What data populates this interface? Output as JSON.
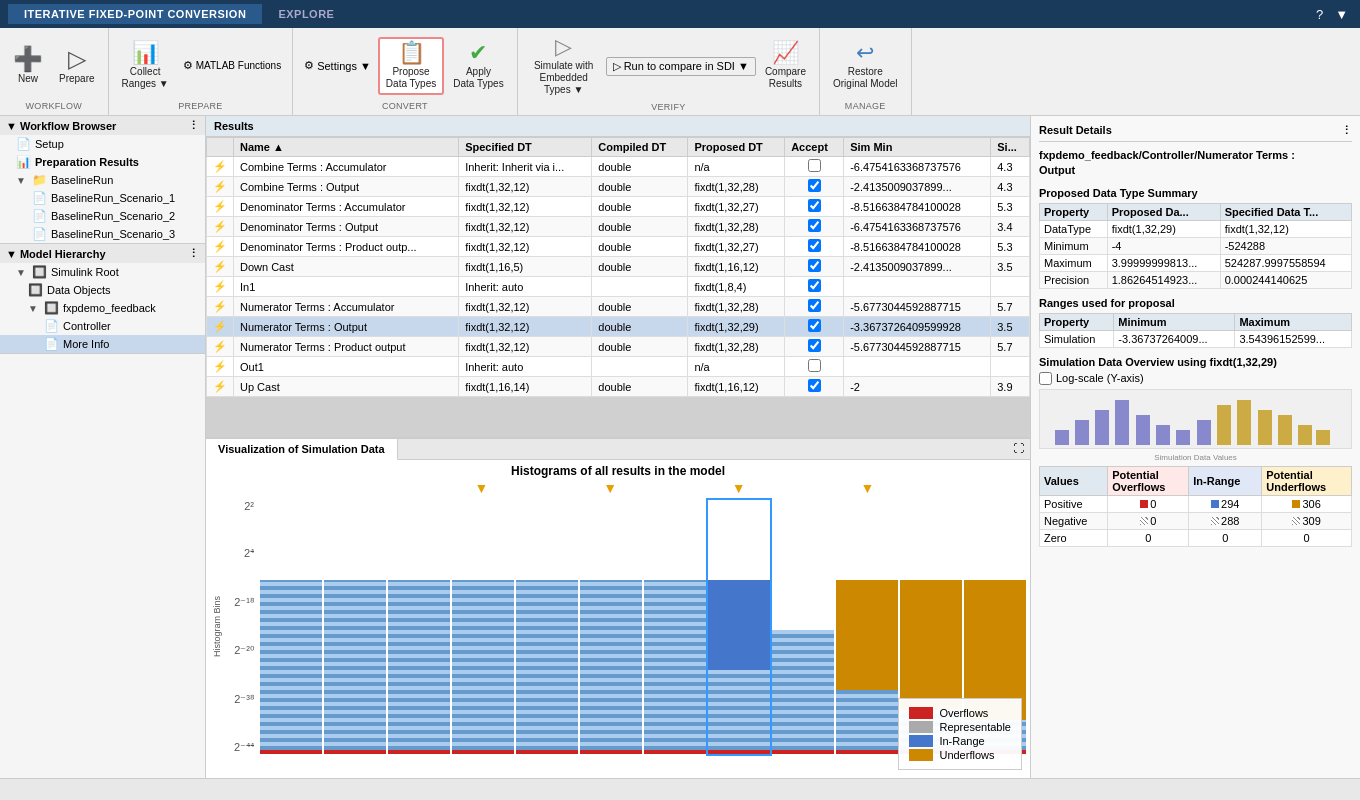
{
  "titleBar": {
    "tabs": [
      {
        "id": "iterative",
        "label": "ITERATIVE FIXED-POINT CONVERSION",
        "active": true
      },
      {
        "id": "explore",
        "label": "EXPLORE",
        "active": false
      }
    ],
    "helpBtn": "?",
    "menuBtn": "▼"
  },
  "ribbon": {
    "groups": [
      {
        "id": "workflow",
        "label": "WORKFLOW",
        "items": [
          {
            "id": "new",
            "icon": "➕",
            "label": "New",
            "type": "btn"
          },
          {
            "id": "prepare",
            "icon": "▶",
            "label": "Prepare",
            "type": "btn"
          }
        ]
      },
      {
        "id": "prepare",
        "label": "PREPARE",
        "items": [
          {
            "id": "collect-ranges",
            "icon": "📊",
            "label": "Collect\nRanges",
            "type": "split"
          },
          {
            "id": "matlab-functions",
            "icon": "⚙",
            "label": "MATLAB Functions",
            "type": "small"
          }
        ]
      },
      {
        "id": "convert",
        "label": "CONVERT",
        "items": [
          {
            "id": "settings",
            "icon": "⚙",
            "label": "Settings ▼",
            "type": "settings"
          },
          {
            "id": "propose-data-types",
            "icon": "📋",
            "label": "Propose\nData Types",
            "type": "btn",
            "active": true
          },
          {
            "id": "apply-data",
            "icon": "✅",
            "label": "Apply\nData Types",
            "type": "btn"
          }
        ]
      },
      {
        "id": "verify",
        "label": "VERIFY",
        "items": [
          {
            "id": "simulate-embedded",
            "icon": "▶",
            "label": "Simulate with\nEmbedded Types",
            "type": "split"
          },
          {
            "id": "run-to-compare",
            "icon": "▶",
            "label": "Run to compare in SDI",
            "type": "run"
          },
          {
            "id": "compare-results",
            "icon": "📈",
            "label": "Compare\nResults",
            "type": "btn"
          }
        ]
      },
      {
        "id": "manage",
        "label": "MANAGE",
        "items": [
          {
            "id": "restore-original",
            "icon": "↩",
            "label": "Restore\nOriginal Model",
            "type": "btn"
          }
        ]
      }
    ]
  },
  "sidebar": {
    "workflowBrowser": {
      "title": "Workflow Browser",
      "items": [
        {
          "id": "setup",
          "label": "Setup",
          "level": 1,
          "icon": "📄"
        },
        {
          "id": "preparation-results",
          "label": "Preparation Results",
          "level": 1,
          "icon": "📊",
          "bold": true
        },
        {
          "id": "baselinerun",
          "label": "BaselineRun",
          "level": 1,
          "icon": "📁",
          "expanded": true
        },
        {
          "id": "scenario1",
          "label": "BaselineRun_Scenario_1",
          "level": 2,
          "icon": "📄"
        },
        {
          "id": "scenario2",
          "label": "BaselineRun_Scenario_2",
          "level": 2,
          "icon": "📄"
        },
        {
          "id": "scenario3",
          "label": "BaselineRun_Scenario_3",
          "level": 2,
          "icon": "📄"
        }
      ]
    },
    "modelHierarchy": {
      "title": "Model Hierarchy",
      "items": [
        {
          "id": "simulink-root",
          "label": "Simulink Root",
          "level": 1,
          "icon": "🔲"
        },
        {
          "id": "data-objects",
          "label": "Data Objects",
          "level": 2,
          "icon": "🔲"
        },
        {
          "id": "fxpdemo",
          "label": "fxpdemo_feedback",
          "level": 2,
          "icon": "🔲",
          "expanded": true
        },
        {
          "id": "controller",
          "label": "Controller",
          "level": 3,
          "icon": "📄"
        },
        {
          "id": "more-info",
          "label": "More Info",
          "level": 3,
          "icon": "📄",
          "selected": true
        }
      ]
    }
  },
  "resultsTable": {
    "header": "Results",
    "columns": [
      "",
      "Name",
      "Specified DT",
      "Compiled DT",
      "Proposed DT",
      "Accept",
      "Sim Min",
      "Si..."
    ],
    "rows": [
      {
        "icon": "⚡",
        "name": "Combine Terms : Accumulator",
        "specifiedDT": "Inherit: Inherit via i...",
        "compiledDT": "double",
        "proposedDT": "n/a",
        "accept": false,
        "simMin": "-6.4754163368737576",
        "si": "4.3"
      },
      {
        "icon": "⚡",
        "name": "Combine Terms : Output",
        "specifiedDT": "fixdt(1,32,12)",
        "compiledDT": "double",
        "proposedDT": "fixdt(1,32,28)",
        "accept": true,
        "simMin": "-2.4135009037899...",
        "si": "4.3",
        "selected": true
      },
      {
        "icon": "⚡",
        "name": "Denominator Terms : Accumulator",
        "specifiedDT": "fixdt(1,32,12)",
        "compiledDT": "double",
        "proposedDT": "fixdt(1,32,27)",
        "accept": true,
        "simMin": "-8.5166384784100028",
        "si": "5.3"
      },
      {
        "icon": "⚡",
        "name": "Denominator Terms : Output",
        "specifiedDT": "fixdt(1,32,12)",
        "compiledDT": "double",
        "proposedDT": "fixdt(1,32,28)",
        "accept": true,
        "simMin": "-6.4754163368737576",
        "si": "3.4"
      },
      {
        "icon": "⚡",
        "name": "Denominator Terms : Product outp...",
        "specifiedDT": "fixdt(1,32,12)",
        "compiledDT": "double",
        "proposedDT": "fixdt(1,32,27)",
        "accept": true,
        "simMin": "-8.5166384784100028",
        "si": "5.3"
      },
      {
        "icon": "⚡",
        "name": "Down Cast",
        "specifiedDT": "fixdt(1,16,5)",
        "compiledDT": "double",
        "proposedDT": "fixdt(1,16,12)",
        "accept": true,
        "simMin": "-2.4135009037899...",
        "si": "3.5"
      },
      {
        "icon": "⚡",
        "name": "In1",
        "specifiedDT": "Inherit: auto",
        "compiledDT": "",
        "proposedDT": "fixdt(1,8,4)",
        "accept": true,
        "simMin": "",
        "si": ""
      },
      {
        "icon": "⚡",
        "name": "Numerator Terms : Accumulator",
        "specifiedDT": "fixdt(1,32,12)",
        "compiledDT": "double",
        "proposedDT": "fixdt(1,32,28)",
        "accept": true,
        "simMin": "-5.6773044592887715",
        "si": "5.7"
      },
      {
        "icon": "⚡",
        "name": "Numerator Terms : Output",
        "specifiedDT": "fixdt(1,32,12)",
        "compiledDT": "double",
        "proposedDT": "fixdt(1,32,29)",
        "accept": true,
        "simMin": "-3.3673726409599928",
        "si": "3.5",
        "highlight": true
      },
      {
        "icon": "⚡",
        "name": "Numerator Terms : Product output",
        "specifiedDT": "fixdt(1,32,12)",
        "compiledDT": "double",
        "proposedDT": "fixdt(1,32,28)",
        "accept": true,
        "simMin": "-5.6773044592887715",
        "si": "5.7"
      },
      {
        "icon": "⚡",
        "name": "Out1",
        "specifiedDT": "Inherit: auto",
        "compiledDT": "",
        "proposedDT": "n/a",
        "accept": false,
        "simMin": "",
        "si": ""
      },
      {
        "icon": "⚡",
        "name": "Up Cast",
        "specifiedDT": "fixdt(1,16,14)",
        "compiledDT": "double",
        "proposedDT": "fixdt(1,16,12)",
        "accept": true,
        "simMin": "-2",
        "si": "3.9"
      }
    ]
  },
  "visualization": {
    "tabLabel": "Visualization of Simulation Data",
    "chartTitle": "Histograms of all results in the model",
    "yAxisLabels": [
      "2²",
      "2⁴",
      "2⁻¹⁸",
      "2⁻²⁰",
      "2⁻³⁸",
      "2⁻⁴⁴"
    ],
    "xAxisLabel": "Histogram Bins",
    "arrowPositions": [
      3,
      5,
      7,
      9
    ],
    "selectedColIndex": 7,
    "legend": [
      {
        "color": "#cc2222",
        "label": "Overflows"
      },
      {
        "color": "#aaaaaa",
        "label": "Representable"
      },
      {
        "color": "#4477cc",
        "label": "In-Range"
      },
      {
        "color": "#cc8800",
        "label": "Underflows"
      }
    ],
    "columns": [
      {
        "overflow": 2,
        "representable": 85,
        "inRange": 0,
        "underflow": 0
      },
      {
        "overflow": 2,
        "representable": 85,
        "inRange": 0,
        "underflow": 0
      },
      {
        "overflow": 2,
        "representable": 85,
        "inRange": 0,
        "underflow": 0
      },
      {
        "overflow": 2,
        "representable": 85,
        "inRange": 0,
        "underflow": 0
      },
      {
        "overflow": 2,
        "representable": 85,
        "inRange": 0,
        "underflow": 0
      },
      {
        "overflow": 2,
        "representable": 85,
        "inRange": 0,
        "underflow": 0
      },
      {
        "overflow": 2,
        "representable": 85,
        "inRange": 0,
        "underflow": 0
      },
      {
        "overflow": 2,
        "representable": 40,
        "inRange": 45,
        "underflow": 0,
        "selected": true
      },
      {
        "overflow": 2,
        "representable": 60,
        "inRange": 0,
        "underflow": 0
      },
      {
        "overflow": 2,
        "representable": 30,
        "inRange": 0,
        "underflow": 55
      },
      {
        "overflow": 2,
        "representable": 20,
        "inRange": 0,
        "underflow": 65
      },
      {
        "overflow": 2,
        "representable": 15,
        "inRange": 0,
        "underflow": 70
      }
    ]
  },
  "rightPanel": {
    "title": "Result Details",
    "detailTitle": "fxpdemo_feedback/Controller/Numerator Terms :\nOutput",
    "proposedSummaryTitle": "Proposed Data Type Summary",
    "proposedTable": {
      "columns": [
        "Property",
        "Proposed Da...",
        "Specified Data T..."
      ],
      "rows": [
        {
          "property": "DataType",
          "proposed": "fixdt(1,32,29)",
          "specified": "fixdt(1,32,12)"
        },
        {
          "property": "Minimum",
          "proposed": "-4",
          "specified": "-524288"
        },
        {
          "property": "Maximum",
          "proposed": "3.99999999813...",
          "specified": "524287.9997558594"
        },
        {
          "property": "Precision",
          "proposed": "1.86264514923...",
          "specified": "0.000244140625"
        }
      ]
    },
    "rangesTitle": "Ranges used for proposal",
    "rangesTable": {
      "columns": [
        "Property",
        "Minimum",
        "Maximum"
      ],
      "rows": [
        {
          "property": "Simulation",
          "min": "-3.36737264009...",
          "max": "3.54396152599..."
        }
      ]
    },
    "simOverviewTitle": "Simulation Data Overview using fixdt(1,32,29)",
    "logScaleLabel": "Log-scale (Y-axis)",
    "simTable": {
      "columns": [
        "Values",
        "Potential\nOverflows",
        "In-Range",
        "Potential\nUnderflows"
      ],
      "rows": [
        {
          "values": "Positive",
          "overflows": "0",
          "inRange": "294",
          "underflows": "306"
        },
        {
          "values": "Negative",
          "overflows": "0",
          "inRange": "288",
          "underflows": "309"
        },
        {
          "values": "Zero",
          "overflows": "0",
          "inRange": "0",
          "underflows": "0"
        }
      ]
    }
  }
}
